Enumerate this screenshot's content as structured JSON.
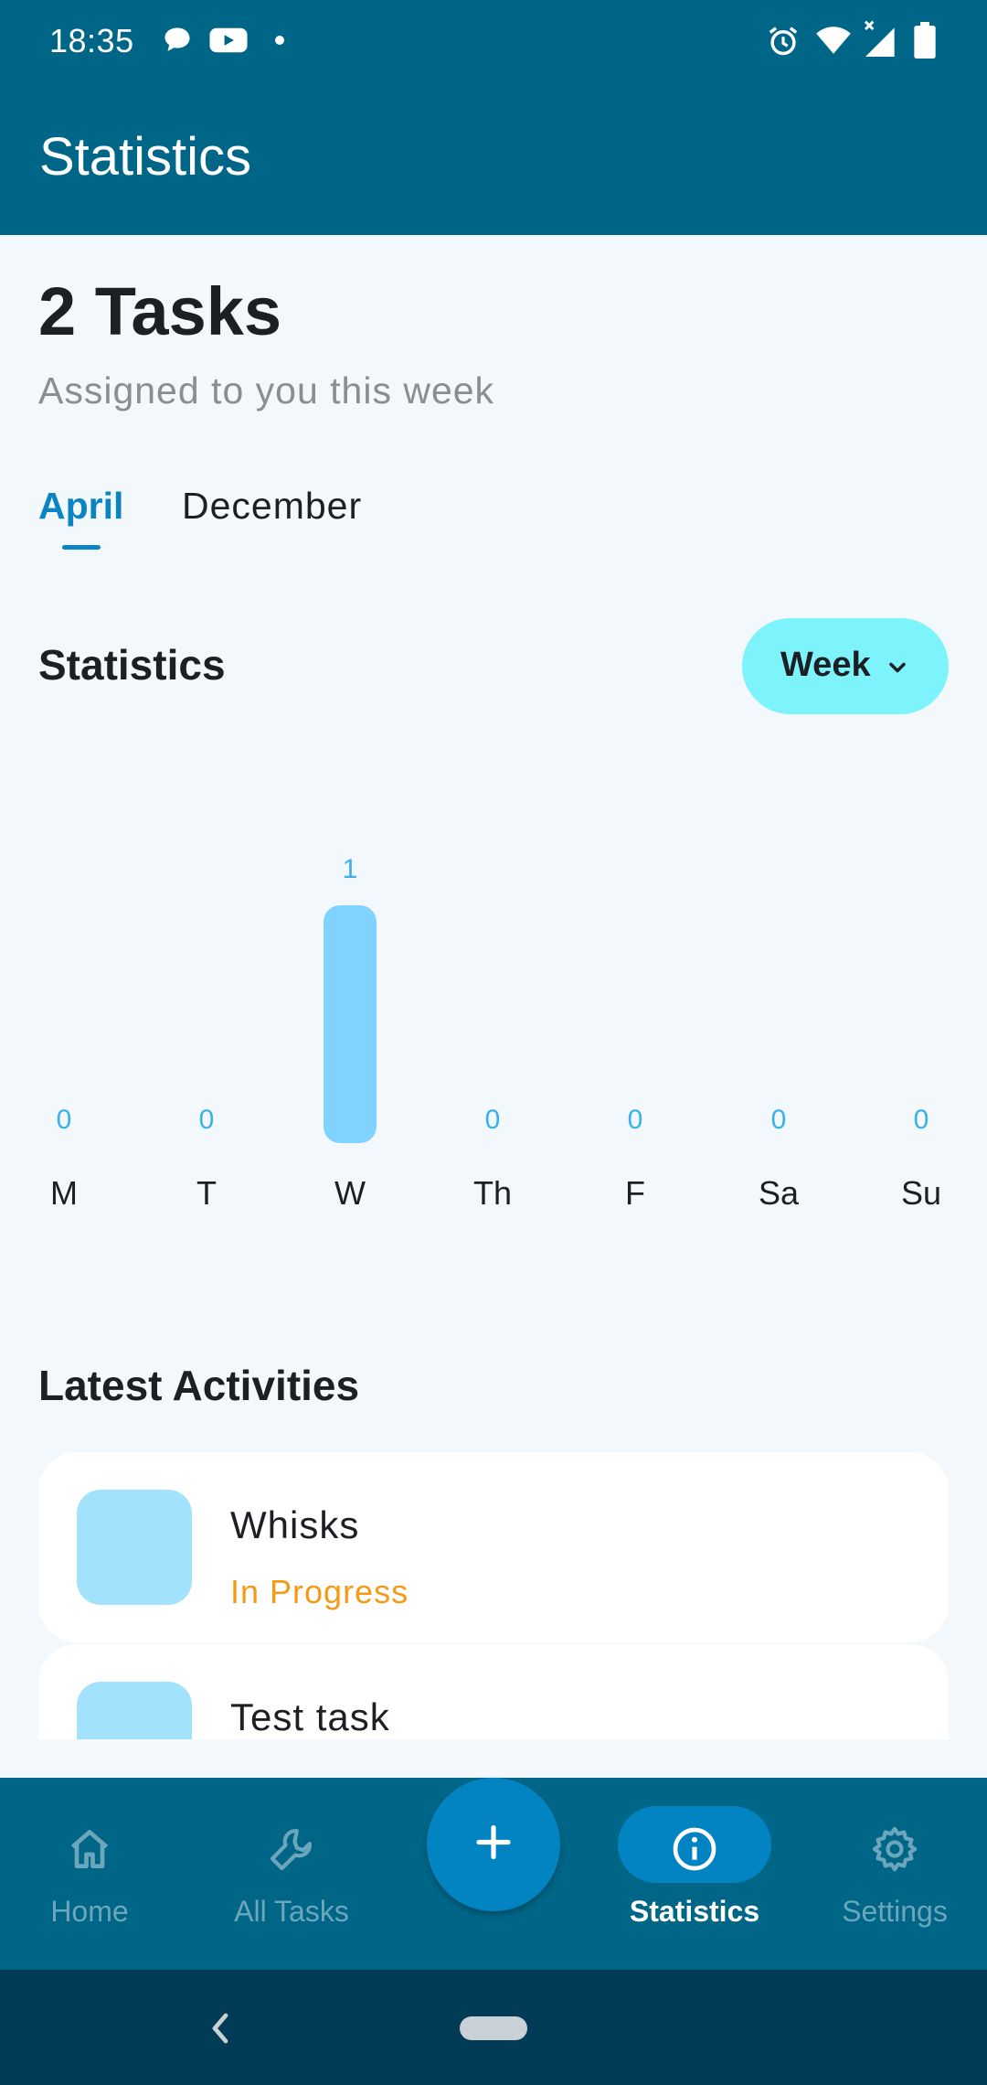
{
  "status_bar": {
    "time": "18:35",
    "left_icons": [
      "chat-bubble-icon",
      "youtube-icon",
      "notification-dot-icon"
    ],
    "right_icons": [
      "alarm-icon",
      "wifi-icon",
      "cellular-no-data-icon",
      "battery-icon"
    ]
  },
  "app_bar": {
    "title": "Statistics"
  },
  "summary": {
    "count_text": "2 Tasks",
    "subtitle": "Assigned to you this week"
  },
  "tabs": [
    {
      "label": "April",
      "selected": true
    },
    {
      "label": "December",
      "selected": false
    }
  ],
  "statistics": {
    "heading": "Statistics",
    "period_label": "Week",
    "period_icon": "chevron-down-icon"
  },
  "chart_data": {
    "type": "bar",
    "categories": [
      "M",
      "T",
      "W",
      "Th",
      "F",
      "Sa",
      "Su"
    ],
    "values": [
      0,
      0,
      1,
      0,
      0,
      0,
      0
    ],
    "ylim": [
      0,
      1
    ],
    "grid": false,
    "data_labels": true
  },
  "latest": {
    "heading": "Latest Activities",
    "items": [
      {
        "name": "Whisks",
        "status": "In Progress"
      },
      {
        "name": "Test task",
        "status": ""
      }
    ]
  },
  "bottom_nav": {
    "items": [
      {
        "label": "Home",
        "icon": "home-icon",
        "active": false
      },
      {
        "label": "All Tasks",
        "icon": "wrench-icon",
        "active": false
      },
      {
        "label": "Statistics",
        "icon": "info-icon",
        "active": true
      },
      {
        "label": "Settings",
        "icon": "gear-icon",
        "active": false
      }
    ],
    "fab_icon": "plus-icon"
  },
  "system_nav": {
    "icons": [
      "back-icon",
      "home-pill"
    ]
  },
  "colors": {
    "primary": "#006688",
    "accent": "#0a84c2",
    "bar": "#80d2ff",
    "period_button": "#7df3fb",
    "status_in_progress": "#f59a17",
    "background": "#f2f8fc"
  }
}
